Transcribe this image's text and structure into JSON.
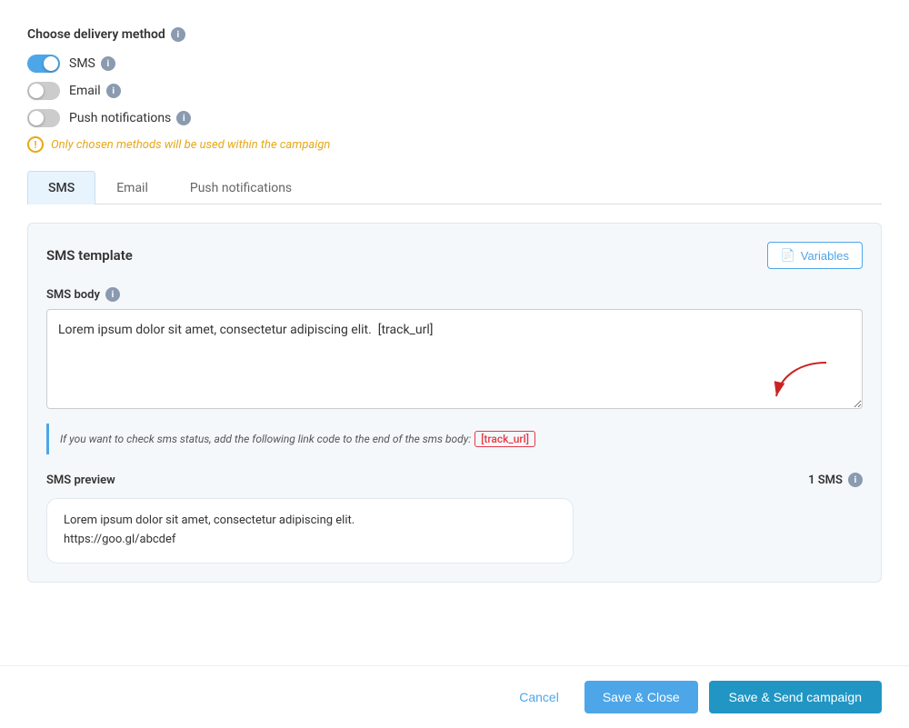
{
  "delivery_method": {
    "title": "Choose delivery method",
    "options": [
      {
        "id": "sms",
        "label": "SMS",
        "enabled": true
      },
      {
        "id": "email",
        "label": "Email",
        "enabled": false
      },
      {
        "id": "push",
        "label": "Push notifications",
        "enabled": false
      }
    ],
    "warning": "Only chosen methods will be used within the campaign"
  },
  "tabs": [
    {
      "id": "sms",
      "label": "SMS",
      "active": true
    },
    {
      "id": "email",
      "label": "Email",
      "active": false
    },
    {
      "id": "push",
      "label": "Push notifications",
      "active": false
    }
  ],
  "sms_template": {
    "title": "SMS template",
    "variables_button": "Variables",
    "body_label": "SMS body",
    "body_value": "Lorem ipsum dolor sit amet, consectetur adipiscing elit.  [track_url]",
    "hint_text": "If you want to check sms status, add the following link code to the end of the sms body:",
    "hint_link": "[track_url]",
    "preview_label": "SMS preview",
    "sms_count_label": "1 SMS",
    "preview_line1": "Lorem ipsum dolor sit amet, consectetur adipiscing elit.",
    "preview_line2": "https://goo.gl/abcdef"
  },
  "footer": {
    "cancel_label": "Cancel",
    "save_close_label": "Save & Close",
    "save_send_label": "Save & Send campaign"
  }
}
